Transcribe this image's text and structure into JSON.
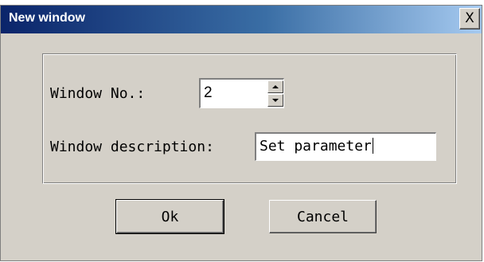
{
  "window": {
    "title": "New window",
    "close_symbol": "X",
    "close_icon": "close-icon"
  },
  "form": {
    "window_no_label": "Window No.:",
    "window_no_value": "2",
    "window_desc_label": "Window description:",
    "window_desc_value": "Set parameter"
  },
  "buttons": {
    "ok": "Ok",
    "cancel": "Cancel"
  },
  "colors": {
    "title_gradient_start": "#0a246a",
    "title_gradient_end": "#a6caf0",
    "dialog_face": "#d4d0c8"
  }
}
